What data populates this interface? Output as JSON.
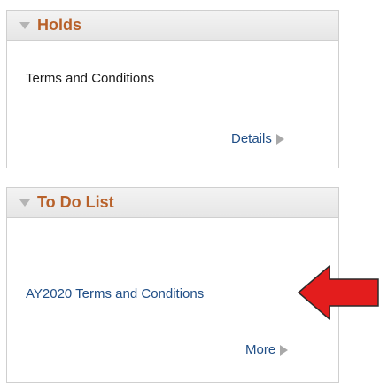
{
  "holds": {
    "title": "Holds",
    "item": "Terms and Conditions",
    "details_link": "Details"
  },
  "todo": {
    "title": "To Do List",
    "item_link": "AY2020 Terms and Conditions",
    "more_link": "More"
  },
  "colors": {
    "title": "#b8612a",
    "link": "#214f87",
    "annotation_arrow": "#e31d1d"
  }
}
